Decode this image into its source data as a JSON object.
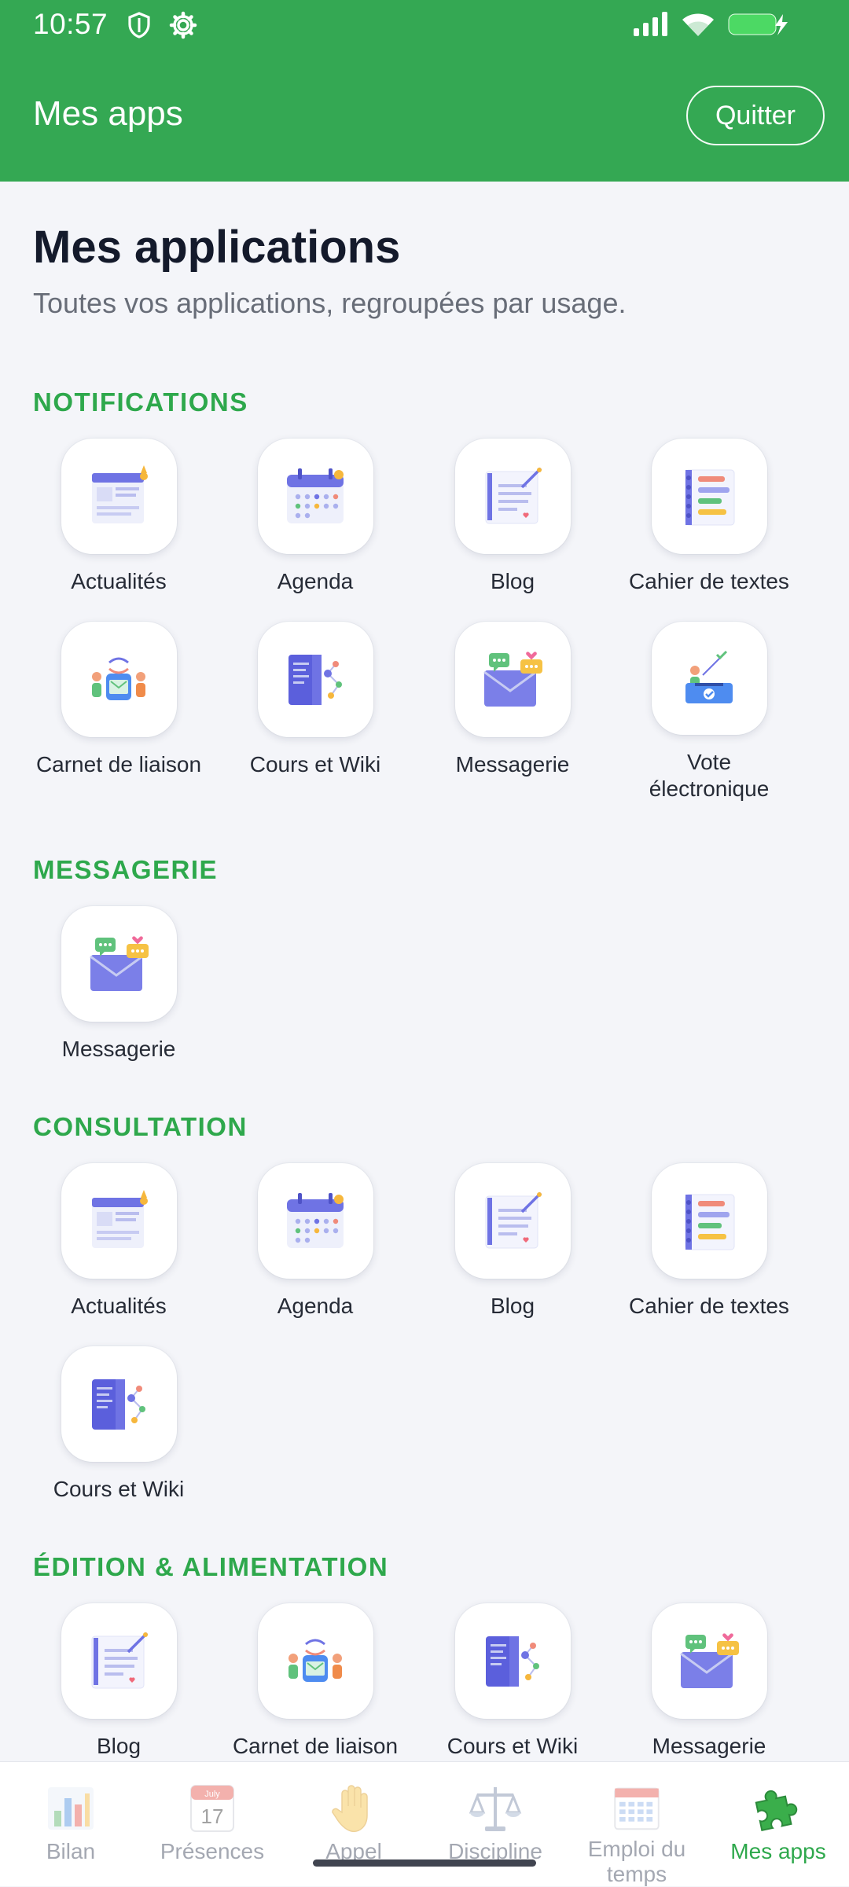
{
  "status_bar": {
    "time": "10:57",
    "icons": [
      "shield-icon",
      "gear-icon",
      "signal-icon",
      "wifi-icon",
      "battery-charging-icon"
    ]
  },
  "app_bar": {
    "title": "Mes apps",
    "quit_label": "Quitter"
  },
  "colors": {
    "brand_green": "#34a853",
    "section_green": "#2ea84c",
    "background": "#f4f5f9"
  },
  "page": {
    "title": "Mes applications",
    "subtitle": "Toutes vos applications, regroupées par usage."
  },
  "sections": [
    {
      "title": "NOTIFICATIONS",
      "apps": [
        {
          "label": "Actualités",
          "icon": "news-icon"
        },
        {
          "label": "Agenda",
          "icon": "calendar-icon"
        },
        {
          "label": "Blog",
          "icon": "blog-icon"
        },
        {
          "label": "Cahier de textes",
          "icon": "notebook-icon"
        },
        {
          "label": "Carnet de liaison",
          "icon": "liaison-icon"
        },
        {
          "label": "Cours et Wiki",
          "icon": "wiki-icon"
        },
        {
          "label": "Messagerie",
          "icon": "mail-icon"
        },
        {
          "label": "Vote électronique",
          "icon": "vote-icon"
        }
      ]
    },
    {
      "title": "MESSAGERIE",
      "apps": [
        {
          "label": "Messagerie",
          "icon": "mail-icon"
        }
      ]
    },
    {
      "title": "CONSULTATION",
      "apps": [
        {
          "label": "Actualités",
          "icon": "news-icon"
        },
        {
          "label": "Agenda",
          "icon": "calendar-icon"
        },
        {
          "label": "Blog",
          "icon": "blog-icon"
        },
        {
          "label": "Cahier de textes",
          "icon": "notebook-icon"
        },
        {
          "label": "Cours et Wiki",
          "icon": "wiki-icon"
        }
      ]
    },
    {
      "title": "ÉDITION & ALIMENTATION",
      "apps": [
        {
          "label": "Blog",
          "icon": "blog-icon"
        },
        {
          "label": "Carnet de liaison",
          "icon": "liaison-icon"
        },
        {
          "label": "Cours et Wiki",
          "icon": "wiki-icon"
        },
        {
          "label": "Messagerie",
          "icon": "mail-icon"
        }
      ]
    }
  ],
  "bottom_nav": {
    "items": [
      {
        "label": "Bilan",
        "icon": "bar-chart-icon",
        "active": false
      },
      {
        "label": "Présences",
        "icon": "calendar-day-icon",
        "calendar_month": "July",
        "calendar_day": "17",
        "active": false
      },
      {
        "label": "Appel",
        "icon": "raised-hand-icon",
        "active": false
      },
      {
        "label": "Discipline",
        "icon": "scales-icon",
        "active": false
      },
      {
        "label": "Emploi du temps",
        "icon": "timetable-icon",
        "active": false
      },
      {
        "label": "Mes apps",
        "icon": "puzzle-icon",
        "active": true
      }
    ]
  }
}
